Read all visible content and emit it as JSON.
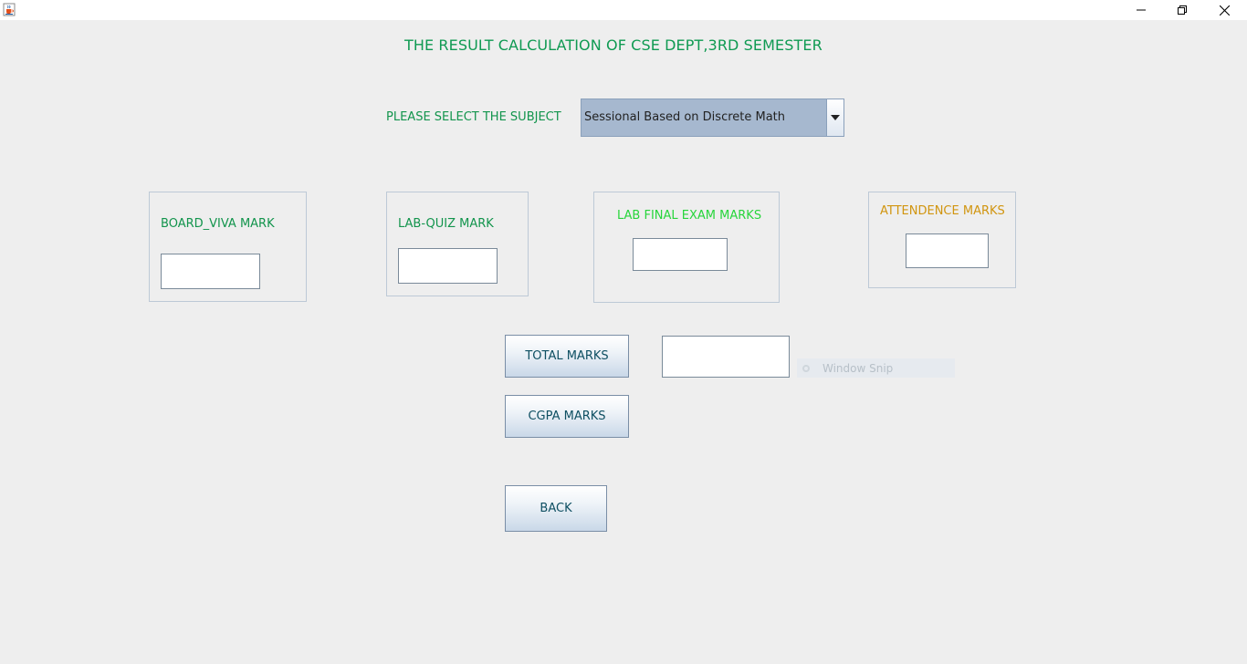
{
  "window": {
    "icon": "java-cup-icon",
    "controls": {
      "minimize": "minimize-icon",
      "maximize": "restore-icon",
      "close": "close-icon"
    }
  },
  "heading": "THE RESULT CALCULATION OF CSE DEPT,3RD SEMESTER",
  "subject": {
    "label": "PLEASE SELECT THE SUBJECT",
    "selected": "Sessional Based on Discrete Math"
  },
  "panels": {
    "board_viva": {
      "label": "BOARD_VIVA MARK",
      "value": ""
    },
    "lab_quiz": {
      "label": "LAB-QUIZ MARK",
      "value": ""
    },
    "lab_final": {
      "label": "LAB FINAL EXAM MARKS",
      "value": ""
    },
    "attendance": {
      "label": "ATTENDENCE MARKS",
      "value": ""
    }
  },
  "actions": {
    "total_label": "TOTAL MARKS",
    "total_value": "",
    "cgpa_label": "CGPA MARKS",
    "back_label": "BACK"
  },
  "overlay": {
    "snip_label": "Window Snip"
  },
  "colors": {
    "heading": "#0f9a52",
    "label_green": "#12944c",
    "lab_final_label": "#27d53b",
    "attendance_label": "#d1950f",
    "button_text": "#0e4f62",
    "combo_bg": "#a6b8cf"
  }
}
